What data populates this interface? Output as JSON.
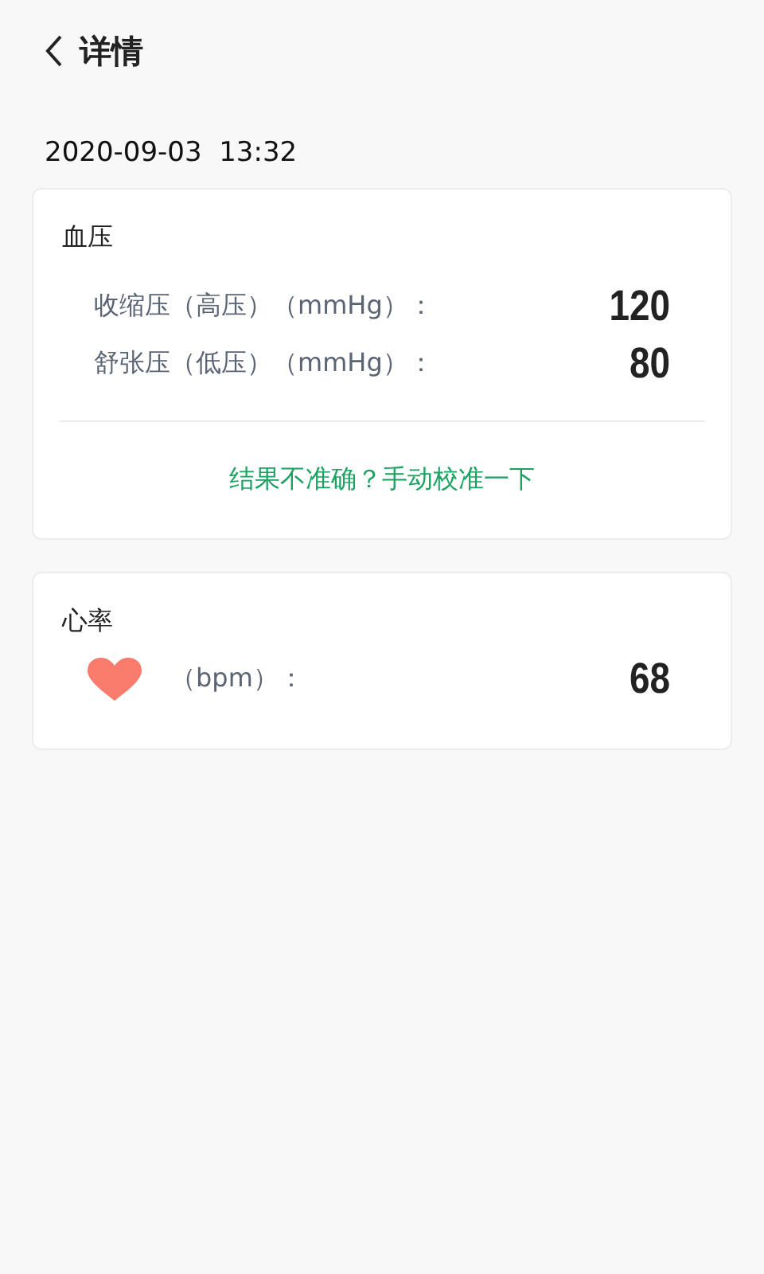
{
  "header": {
    "title": "详情"
  },
  "datetime": "2020-09-03  13:32",
  "blood_pressure": {
    "title": "血压",
    "rows": [
      {
        "label": "收缩压（高压）（mmHg）：",
        "value": "120"
      },
      {
        "label": "舒张压（低压）（mmHg）：",
        "value": "80"
      }
    ],
    "calibrate_link": "结果不准确？手动校准一下"
  },
  "heart_rate": {
    "title": "心率",
    "label": "（bpm）：",
    "value": "68"
  }
}
